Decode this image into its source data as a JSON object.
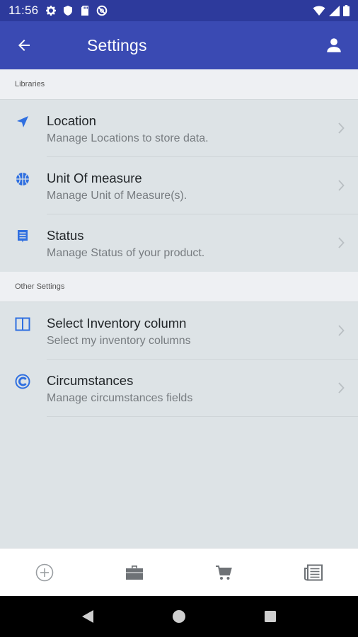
{
  "status_bar": {
    "time": "11:56",
    "left_icons": [
      "settings-gear-icon",
      "shield-icon",
      "sd-card-icon",
      "do-not-disturb-icon"
    ],
    "right_icons": [
      "wifi-icon",
      "signal-icon",
      "battery-icon"
    ]
  },
  "app_bar": {
    "title": "Settings",
    "back_icon": "arrow-left-icon",
    "user_icon": "account-icon",
    "color": "#3a4ab3"
  },
  "sections": [
    {
      "header": "Libraries",
      "items": [
        {
          "title": "Location",
          "subtitle": "Manage Locations to store data.",
          "icon": "navigation-arrow-icon"
        },
        {
          "title": "Unit Of measure",
          "subtitle": "Manage Unit of Measure(s).",
          "icon": "basketball-icon"
        },
        {
          "title": "Status",
          "subtitle": "Manage Status of your product.",
          "icon": "list-status-icon"
        }
      ]
    },
    {
      "header": "Other Settings",
      "items": [
        {
          "title": "Select Inventory column",
          "subtitle": "Select my inventory columns",
          "icon": "columns-icon"
        },
        {
          "title": "Circumstances",
          "subtitle": "Manage circumstances fields",
          "icon": "circle-c-icon"
        }
      ]
    }
  ],
  "accent_color": "#2f6fe0",
  "bottom_nav": [
    "add-circle-icon",
    "briefcase-icon",
    "cart-icon",
    "newspaper-icon"
  ],
  "system_nav": [
    "back-triangle-icon",
    "home-circle-icon",
    "recents-square-icon"
  ]
}
